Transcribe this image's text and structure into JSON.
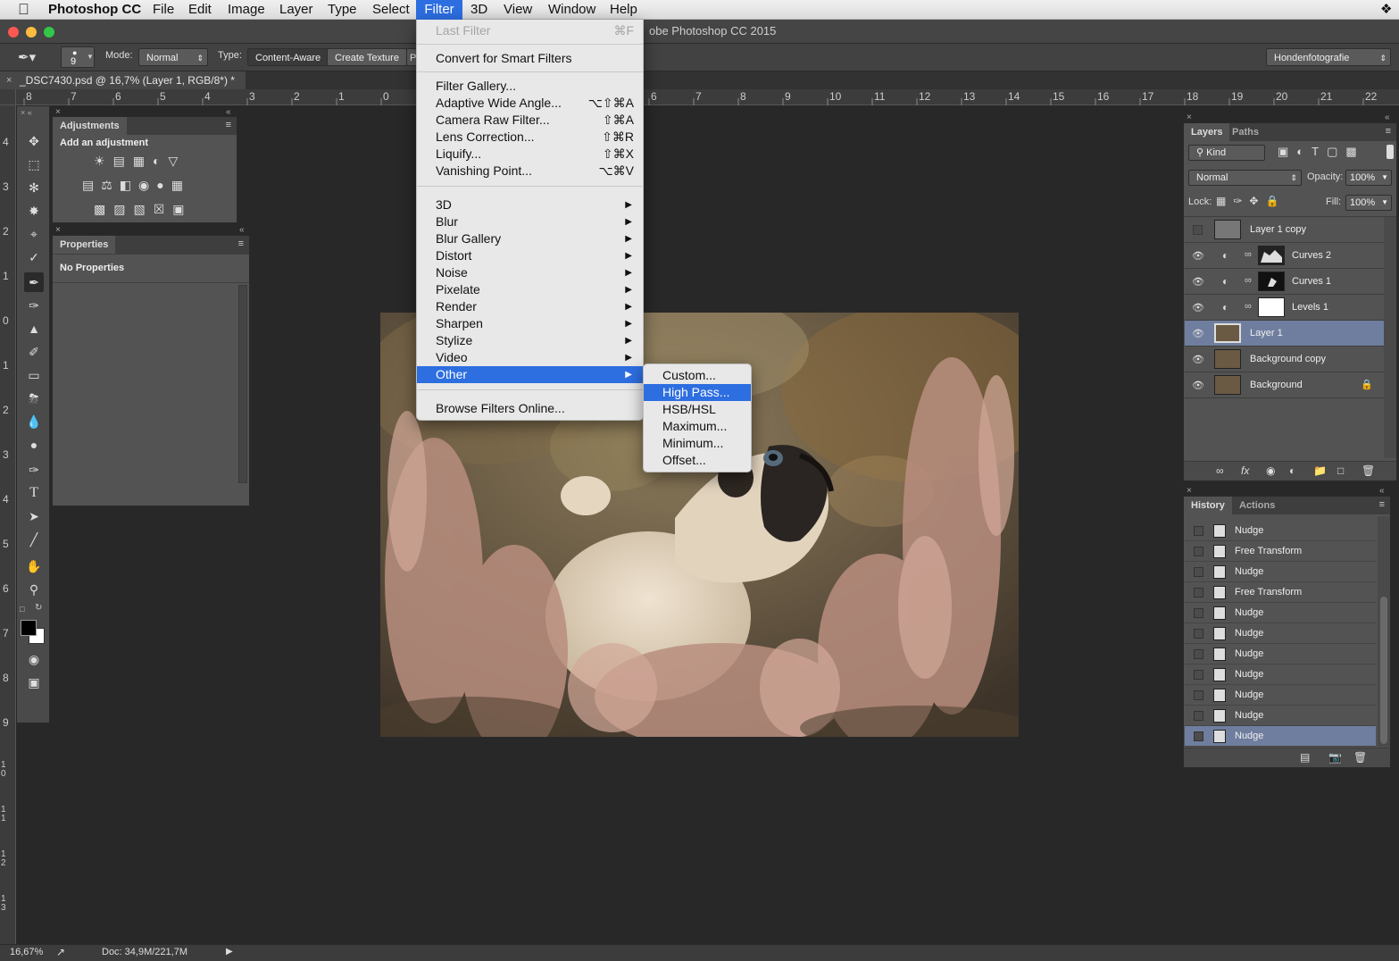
{
  "menubar": {
    "apple": "",
    "app": "Photoshop CC",
    "items": [
      "File",
      "Edit",
      "Image",
      "Layer",
      "Type",
      "Select",
      "Filter",
      "3D",
      "View",
      "Window",
      "Help"
    ]
  },
  "window": {
    "title": "Adobe Photoshop CC 2015",
    "title_visible": "obe Photoshop CC 2015"
  },
  "options_bar": {
    "brush_size": "9",
    "mode_label": "Mode:",
    "mode_value": "Normal",
    "type_label": "Type:",
    "type_opt1": "Content-Aware",
    "type_opt2": "Create Texture",
    "type_opt3": "P",
    "workspace": "Hondenfotografie"
  },
  "document_tab": {
    "label": "_DSC7430.psd @ 16,7% (Layer 1, RGB/8*) *"
  },
  "rulers": {
    "h_ticks": [
      "8",
      "7",
      "6",
      "5",
      "4",
      "3",
      "2",
      "1",
      "0",
      "6",
      "7",
      "8",
      "9",
      "10",
      "11",
      "12",
      "13",
      "14",
      "15",
      "16",
      "17",
      "18",
      "19",
      "20",
      "21",
      "22"
    ],
    "v_ticks": [
      "4",
      "3",
      "2",
      "1",
      "0",
      "1",
      "2",
      "3",
      "4",
      "5",
      "6",
      "7",
      "8",
      "9",
      "10",
      "11",
      "12",
      "13"
    ]
  },
  "filter_menu": {
    "last_filter": "Last Filter",
    "last_filter_sc": "⌘F",
    "convert": "Convert for Smart Filters",
    "items_group1": [
      {
        "label": "Filter Gallery...",
        "sc": ""
      },
      {
        "label": "Adaptive Wide Angle...",
        "sc": "⌥⇧⌘A"
      },
      {
        "label": "Camera Raw Filter...",
        "sc": "⇧⌘A"
      },
      {
        "label": "Lens Correction...",
        "sc": "⇧⌘R"
      },
      {
        "label": "Liquify...",
        "sc": "⇧⌘X"
      },
      {
        "label": "Vanishing Point...",
        "sc": "⌥⌘V"
      }
    ],
    "items_group2": [
      "3D",
      "Blur",
      "Blur Gallery",
      "Distort",
      "Noise",
      "Pixelate",
      "Render",
      "Sharpen",
      "Stylize",
      "Video",
      "Other"
    ],
    "browse": "Browse Filters Online..."
  },
  "other_submenu": {
    "items": [
      "Custom...",
      "High Pass...",
      "HSB/HSL",
      "Maximum...",
      "Minimum...",
      "Offset..."
    ],
    "highlighted": "High Pass..."
  },
  "adjustments_panel": {
    "tab": "Adjustments",
    "heading": "Add an adjustment"
  },
  "properties_panel": {
    "tab": "Properties",
    "text": "No Properties"
  },
  "layers_panel": {
    "tabs": [
      "Layers",
      "Paths"
    ],
    "kind": "Kind",
    "blend": "Normal",
    "opacity_label": "Opacity:",
    "opacity": "100%",
    "lock_label": "Lock:",
    "fill_label": "Fill:",
    "fill": "100%",
    "layers": [
      {
        "name": "Layer 1 copy",
        "visible": false,
        "selected": false
      },
      {
        "name": "Curves 2",
        "visible": true,
        "selected": false
      },
      {
        "name": "Curves 1",
        "visible": true,
        "selected": false
      },
      {
        "name": "Levels 1",
        "visible": true,
        "selected": false
      },
      {
        "name": "Layer 1",
        "visible": true,
        "selected": true
      },
      {
        "name": "Background copy",
        "visible": true,
        "selected": false
      },
      {
        "name": "Background",
        "visible": true,
        "selected": false
      }
    ]
  },
  "history_panel": {
    "tabs": [
      "History",
      "Actions"
    ],
    "items": [
      "Nudge",
      "Free Transform",
      "Nudge",
      "Free Transform",
      "Nudge",
      "Nudge",
      "Nudge",
      "Nudge",
      "Nudge",
      "Nudge",
      "Nudge"
    ]
  },
  "status_bar": {
    "zoom": "16,67%",
    "doc": "Doc: 34,9M/221,7M"
  },
  "colors": {
    "menu_highlight": "#2d6ee0",
    "layer_selected": "#6f7e9e",
    "panel_bg": "#535353",
    "workspace_bg": "#282828"
  }
}
